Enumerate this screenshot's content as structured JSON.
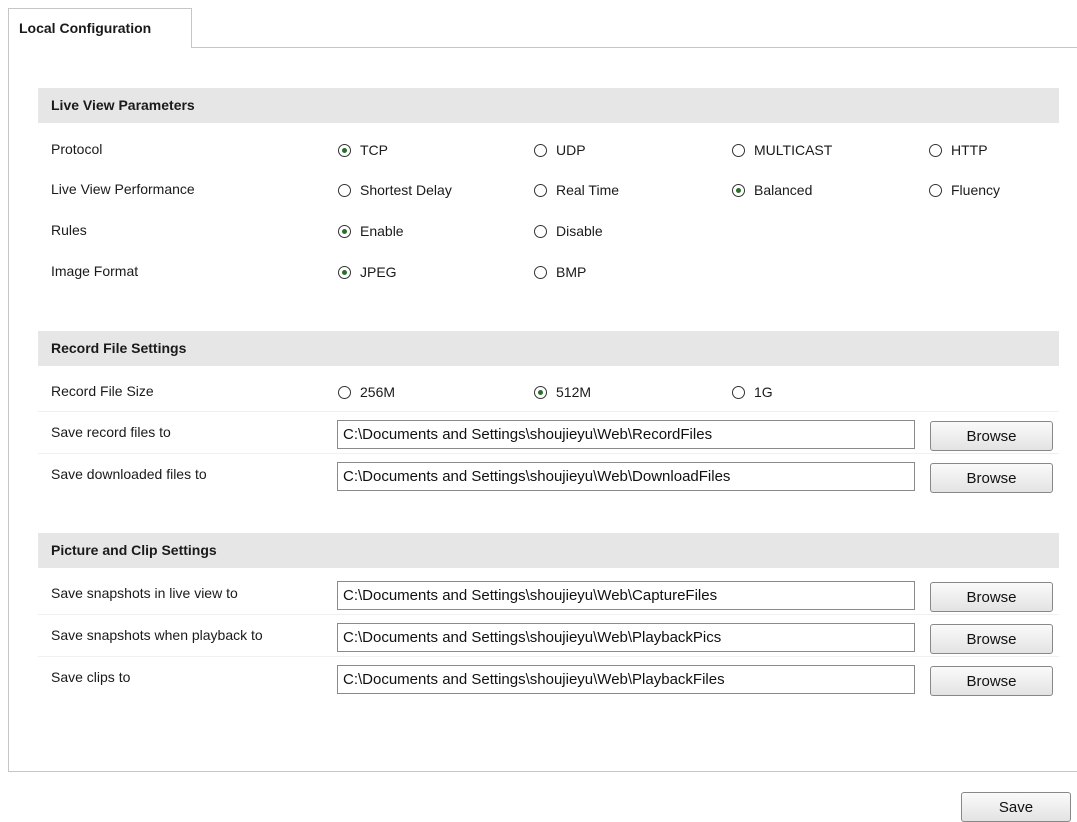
{
  "tab": {
    "label": "Local Configuration"
  },
  "live_view": {
    "title": "Live View Parameters",
    "protocol": {
      "label": "Protocol",
      "options": [
        "TCP",
        "UDP",
        "MULTICAST",
        "HTTP"
      ],
      "selected": "TCP"
    },
    "performance": {
      "label": "Live View Performance",
      "options": [
        "Shortest Delay",
        "Real Time",
        "Balanced",
        "Fluency"
      ],
      "selected": "Balanced"
    },
    "rules": {
      "label": "Rules",
      "options": [
        "Enable",
        "Disable"
      ],
      "selected": "Enable"
    },
    "image_format": {
      "label": "Image Format",
      "options": [
        "JPEG",
        "BMP"
      ],
      "selected": "JPEG"
    }
  },
  "record": {
    "title": "Record File Settings",
    "file_size": {
      "label": "Record File Size",
      "options": [
        "256M",
        "512M",
        "1G"
      ],
      "selected": "512M"
    },
    "record_path": {
      "label": "Save record files to",
      "value": "C:\\Documents and Settings\\shoujieyu\\Web\\RecordFiles"
    },
    "download_path": {
      "label": "Save downloaded files to",
      "value": "C:\\Documents and Settings\\shoujieyu\\Web\\DownloadFiles"
    }
  },
  "picture": {
    "title": "Picture and Clip Settings",
    "snapshot_live": {
      "label": "Save snapshots in live view to",
      "value": "C:\\Documents and Settings\\shoujieyu\\Web\\CaptureFiles"
    },
    "snapshot_playback": {
      "label": "Save snapshots when playback to",
      "value": "C:\\Documents and Settings\\shoujieyu\\Web\\PlaybackPics"
    },
    "clips": {
      "label": "Save clips to",
      "value": "C:\\Documents and Settings\\shoujieyu\\Web\\PlaybackFiles"
    }
  },
  "buttons": {
    "browse": "Browse",
    "save": "Save"
  },
  "colors": {
    "section_bg": "#e6e6e6",
    "border": "#c6c6c6",
    "radio_dot": "#2a6e2a"
  }
}
